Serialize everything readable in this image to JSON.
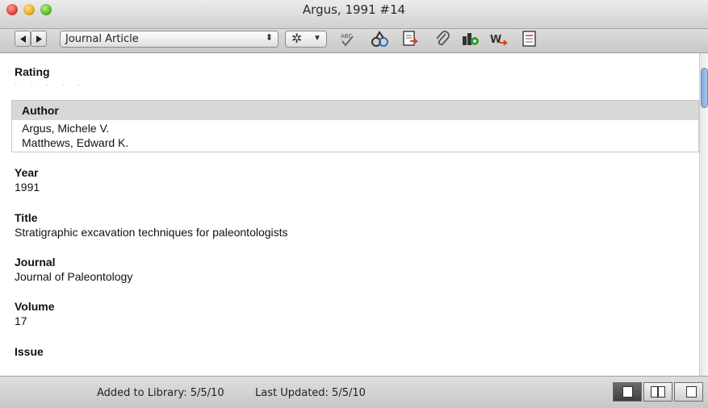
{
  "window": {
    "title": "Argus, 1991 #14"
  },
  "toolbar": {
    "back_icon": "back-arrow-icon",
    "forward_icon": "forward-arrow-icon",
    "reference_type": "Journal Article",
    "tools": [
      "spellcheck-icon",
      "find-fulltext-icon",
      "export-reference-icon",
      "attach-file-icon",
      "insert-figure-icon",
      "web-link-icon",
      "edit-fields-icon"
    ]
  },
  "fields": {
    "rating": {
      "label": "Rating",
      "value": "· · · · ·"
    },
    "author": {
      "label": "Author",
      "values": [
        "Argus, Michele V.",
        "Matthews, Edward K."
      ]
    },
    "year": {
      "label": "Year",
      "value": "1991"
    },
    "title": {
      "label": "Title",
      "value": "Stratigraphic excavation techniques for paleontologists"
    },
    "journal": {
      "label": "Journal",
      "value": "Journal of Paleontology"
    },
    "volume": {
      "label": "Volume",
      "value": "17"
    },
    "issue": {
      "label": "Issue",
      "value": ""
    }
  },
  "status": {
    "added": "Added to Library: 5/5/10",
    "updated": "Last Updated: 5/5/10"
  },
  "layout_buttons": [
    "layout-single-pane",
    "layout-split-pane",
    "layout-right-pane"
  ],
  "colors": {
    "selection_gray": "#d8d8d8",
    "scroll_blue": "#7fa8d9"
  }
}
